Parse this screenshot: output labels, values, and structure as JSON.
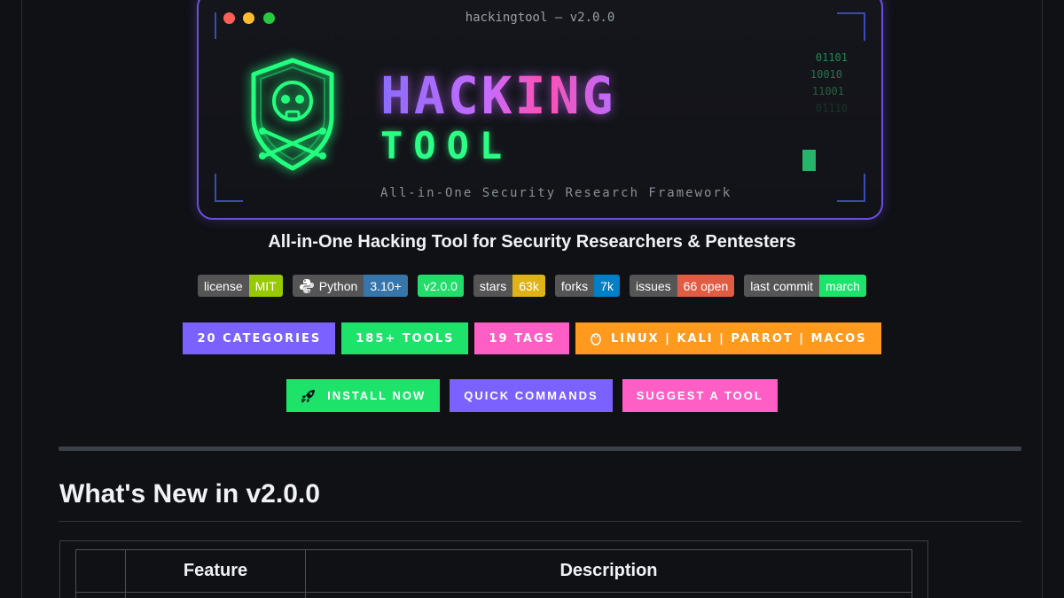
{
  "banner": {
    "window_title": "hackingtool — v2.0.0",
    "logo_line1": "HACKING",
    "logo_line2": "TOOL",
    "logo_subtitle": "All-in-One Security Research Framework",
    "binary_lines": [
      "01101",
      "10010",
      "11001",
      "01110"
    ],
    "icon": "skull-shield-icon"
  },
  "tagline": "All-in-One Hacking Tool for Security Researchers & Pentesters",
  "badges": [
    {
      "label": "license",
      "value": "MIT",
      "color": "#97ca00"
    },
    {
      "label": "Python",
      "value": "3.10+",
      "color": "#3776ab",
      "icon": "python-icon"
    },
    {
      "label": "",
      "value": "v2.0.0",
      "color": "#22dd6a"
    },
    {
      "label": "stars",
      "value": "63k",
      "color": "#dfb317"
    },
    {
      "label": "forks",
      "value": "7k",
      "color": "#007ec6"
    },
    {
      "label": "issues",
      "value": "66 open",
      "color": "#e05d44"
    },
    {
      "label": "last commit",
      "value": "march",
      "color": "#1ee36b"
    }
  ],
  "info_chips": [
    {
      "text": "20 CATEGORIES",
      "color": "#7b61ff"
    },
    {
      "text": "185+ TOOLS",
      "color": "#1ee36b"
    },
    {
      "text": "19 TAGS",
      "color": "#ff5fc4"
    },
    {
      "text": "LINUX | KALI | PARROT | MACOS",
      "color": "#ff9a1f",
      "icon": "linux-penguin-icon"
    }
  ],
  "actions": [
    {
      "text": "INSTALL NOW",
      "color": "#1ee36b",
      "icon": "rocket-icon"
    },
    {
      "text": "QUICK COMMANDS",
      "color": "#7b61ff"
    },
    {
      "text": "SUGGEST A TOOL",
      "color": "#ff5fc4"
    }
  ],
  "section": {
    "title": "What's New in v2.0.0",
    "table_headers": [
      "",
      "Feature",
      "Description"
    ]
  }
}
